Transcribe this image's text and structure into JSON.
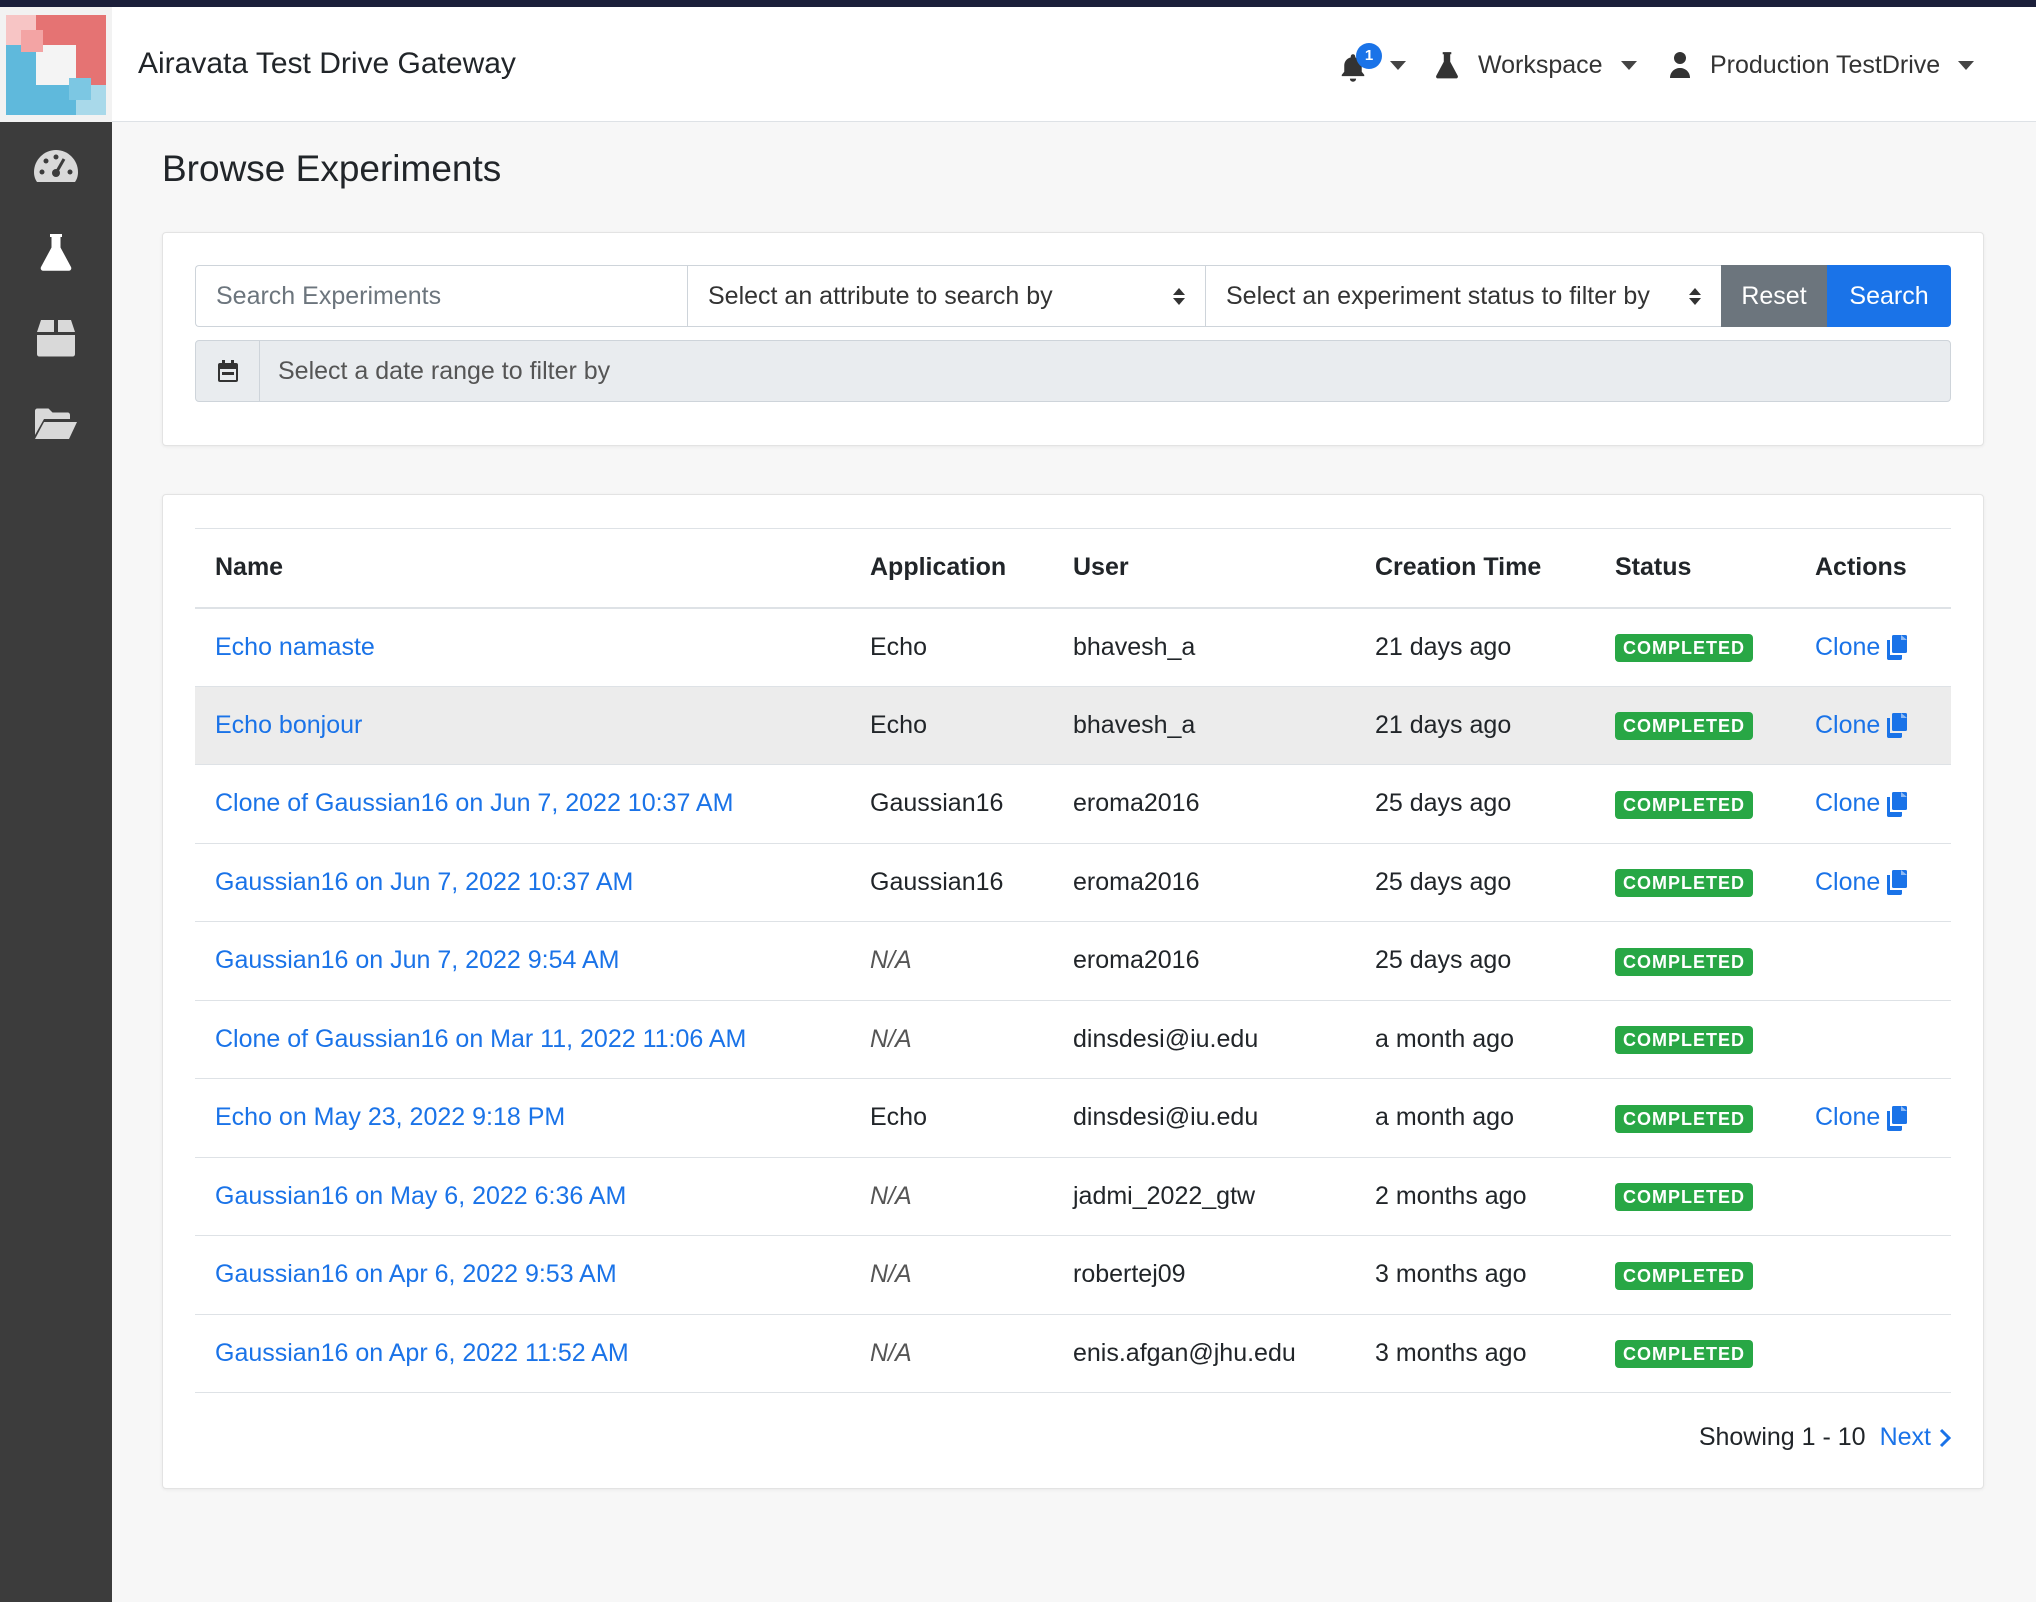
{
  "app": {
    "title": "Airavata Test Drive Gateway"
  },
  "header": {
    "notifications": {
      "count": "1"
    },
    "workspace_label": "Workspace",
    "user_label": "Production TestDrive"
  },
  "sidebar": {
    "items": [
      {
        "icon": "dashboard-icon"
      },
      {
        "icon": "flask-icon"
      },
      {
        "icon": "box-icon"
      },
      {
        "icon": "folder-open-icon"
      }
    ]
  },
  "page": {
    "title": "Browse Experiments"
  },
  "search": {
    "placeholder": "Search Experiments",
    "attribute_select": "Select an attribute to search by",
    "status_select": "Select an experiment status to filter by",
    "reset_label": "Reset",
    "search_label": "Search",
    "date_placeholder": "Select a date range to filter by"
  },
  "table": {
    "columns": [
      "Name",
      "Application",
      "User",
      "Creation Time",
      "Status",
      "Actions"
    ],
    "rows": [
      {
        "name": "Echo namaste",
        "application": "Echo",
        "user": "bhavesh_a",
        "time": "21 days ago",
        "status": "COMPLETED",
        "action": "Clone"
      },
      {
        "name": "Echo bonjour",
        "application": "Echo",
        "user": "bhavesh_a",
        "time": "21 days ago",
        "status": "COMPLETED",
        "action": "Clone"
      },
      {
        "name": "Clone of Gaussian16 on Jun 7, 2022 10:37 AM",
        "application": "Gaussian16",
        "user": "eroma2016",
        "time": "25 days ago",
        "status": "COMPLETED",
        "action": "Clone"
      },
      {
        "name": "Gaussian16 on Jun 7, 2022 10:37 AM",
        "application": "Gaussian16",
        "user": "eroma2016",
        "time": "25 days ago",
        "status": "COMPLETED",
        "action": "Clone"
      },
      {
        "name": "Gaussian16 on Jun 7, 2022 9:54 AM",
        "application": "N/A",
        "user": "eroma2016",
        "time": "25 days ago",
        "status": "COMPLETED",
        "action": ""
      },
      {
        "name": "Clone of Gaussian16 on Mar 11, 2022 11:06 AM",
        "application": "N/A",
        "user": "dinsdesi@iu.edu",
        "time": "a month ago",
        "status": "COMPLETED",
        "action": ""
      },
      {
        "name": "Echo on May 23, 2022 9:18 PM",
        "application": "Echo",
        "user": "dinsdesi@iu.edu",
        "time": "a month ago",
        "status": "COMPLETED",
        "action": "Clone"
      },
      {
        "name": "Gaussian16 on May 6, 2022 6:36 AM",
        "application": "N/A",
        "user": "jadmi_2022_gtw",
        "time": "2 months ago",
        "status": "COMPLETED",
        "action": ""
      },
      {
        "name": "Gaussian16 on Apr 6, 2022 9:53 AM",
        "application": "N/A",
        "user": "robertej09",
        "time": "3 months ago",
        "status": "COMPLETED",
        "action": ""
      },
      {
        "name": "Gaussian16 on Apr 6, 2022 11:52 AM",
        "application": "N/A",
        "user": "enis.afgan@jhu.edu",
        "time": "3 months ago",
        "status": "COMPLETED",
        "action": ""
      }
    ]
  },
  "pagination": {
    "showing": "Showing 1 - 10",
    "next_label": "Next"
  },
  "colors": {
    "accent": "#1a73e8",
    "success": "#28a745",
    "sidebar": "#3c3c3c",
    "reset": "#6c757d"
  }
}
